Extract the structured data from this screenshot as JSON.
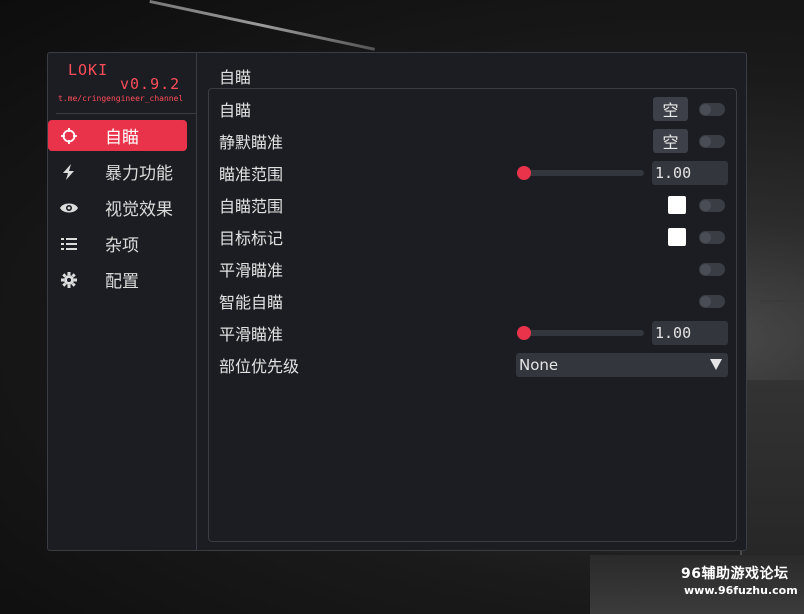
{
  "logo": {
    "name": "LOKI",
    "version": "v0.9.2",
    "channel": "t.me/cringengineer_channel"
  },
  "sidebar": {
    "items": [
      {
        "label": "自瞄",
        "icon": "crosshair-icon",
        "active": true
      },
      {
        "label": "暴力功能",
        "icon": "bolt-icon",
        "active": false
      },
      {
        "label": "视觉效果",
        "icon": "eye-icon",
        "active": false
      },
      {
        "label": "杂项",
        "icon": "list-icon",
        "active": false
      },
      {
        "label": "配置",
        "icon": "gear-icon",
        "active": false
      }
    ]
  },
  "main": {
    "title": "自瞄",
    "rows": [
      {
        "label": "自瞄",
        "key": "空",
        "toggle": false
      },
      {
        "label": "静默瞄准",
        "key": "空",
        "toggle": false
      },
      {
        "label": "瞄准范围",
        "value": "1.00",
        "fraction": 0
      },
      {
        "label": "自瞄范围",
        "color": "#ffffff",
        "toggle": false
      },
      {
        "label": "目标标记",
        "color": "#ffffff",
        "toggle": false
      },
      {
        "label": "平滑瞄准",
        "toggle": false
      },
      {
        "label": "智能自瞄",
        "toggle": false
      },
      {
        "label": "平滑瞄准",
        "value": "1.00",
        "fraction": 0
      },
      {
        "label": "部位优先级",
        "select": "None"
      }
    ]
  },
  "watermark": {
    "line1": "96辅助游戏论坛",
    "line2": "www.96fuzhu.com"
  },
  "colors": {
    "accent": "#e8334a",
    "logo": "#ff4d5a",
    "panel_bg": "#1b1d22"
  }
}
